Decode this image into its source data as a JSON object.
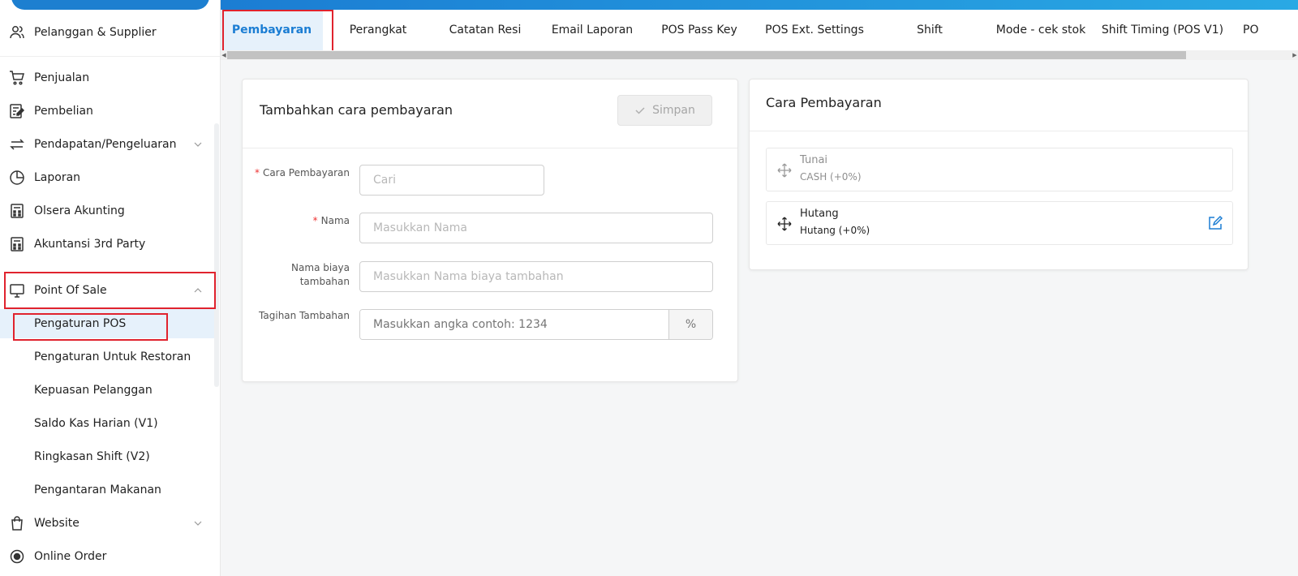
{
  "sidebar": {
    "items": [
      {
        "label": "Pelanggan & Supplier",
        "icon": "users-icon"
      },
      {
        "label": "Penjualan",
        "icon": "cart-icon"
      },
      {
        "label": "Pembelian",
        "icon": "purchase-doc-icon"
      },
      {
        "label": "Pendapatan/Pengeluaran",
        "icon": "transfer-icon"
      },
      {
        "label": "Laporan",
        "icon": "pie-chart-icon"
      },
      {
        "label": "Olsera Akunting",
        "icon": "calculator-icon"
      },
      {
        "label": "Akuntansi 3rd Party",
        "icon": "calculator-icon"
      },
      {
        "label": "Point Of Sale",
        "icon": "monitor-icon"
      },
      {
        "label": "Website",
        "icon": "shopping-bag-icon"
      },
      {
        "label": "Online Order",
        "icon": "radio-circle-icon"
      }
    ],
    "pos_subitems": [
      "Pengaturan POS",
      "Pengaturan Untuk Restoran",
      "Kepuasan Pelanggan",
      "Saldo Kas Harian (V1)",
      "Ringkasan Shift (V2)",
      "Pengantaran Makanan"
    ]
  },
  "tabs": [
    "Pembayaran",
    "Perangkat",
    "Catatan Resi",
    "Email Laporan",
    "POS Pass Key",
    "POS Ext. Settings",
    "Shift",
    "Mode - cek stok",
    "Shift Timing (POS V1)",
    "PO"
  ],
  "form": {
    "title": "Tambahkan cara pembayaran",
    "save_label": "Simpan",
    "fields": {
      "cara_label": "Cara Pembayaran",
      "cara_placeholder": "Cari",
      "nama_label": "Nama",
      "nama_placeholder": "Masukkan Nama",
      "biaya_label_1": "Nama biaya",
      "biaya_label_2": "tambahan",
      "biaya_placeholder": "Masukkan Nama biaya tambahan",
      "tagihan_label": "Tagihan Tambahan",
      "tagihan_placeholder": "Masukkan angka contoh: 1234",
      "tagihan_suffix": "%"
    }
  },
  "payment_methods": {
    "title": "Cara Pembayaran",
    "items": [
      {
        "name": "Tunai",
        "detail": "CASH (+0%)",
        "disabled": true
      },
      {
        "name": "Hutang",
        "detail": "Hutang (+0%)",
        "disabled": false
      }
    ]
  },
  "colors": {
    "primary": "#1b7dd3",
    "active_bg": "#e6f1fb",
    "highlight_box": "#e0232e",
    "required_mark": "#e33333"
  }
}
